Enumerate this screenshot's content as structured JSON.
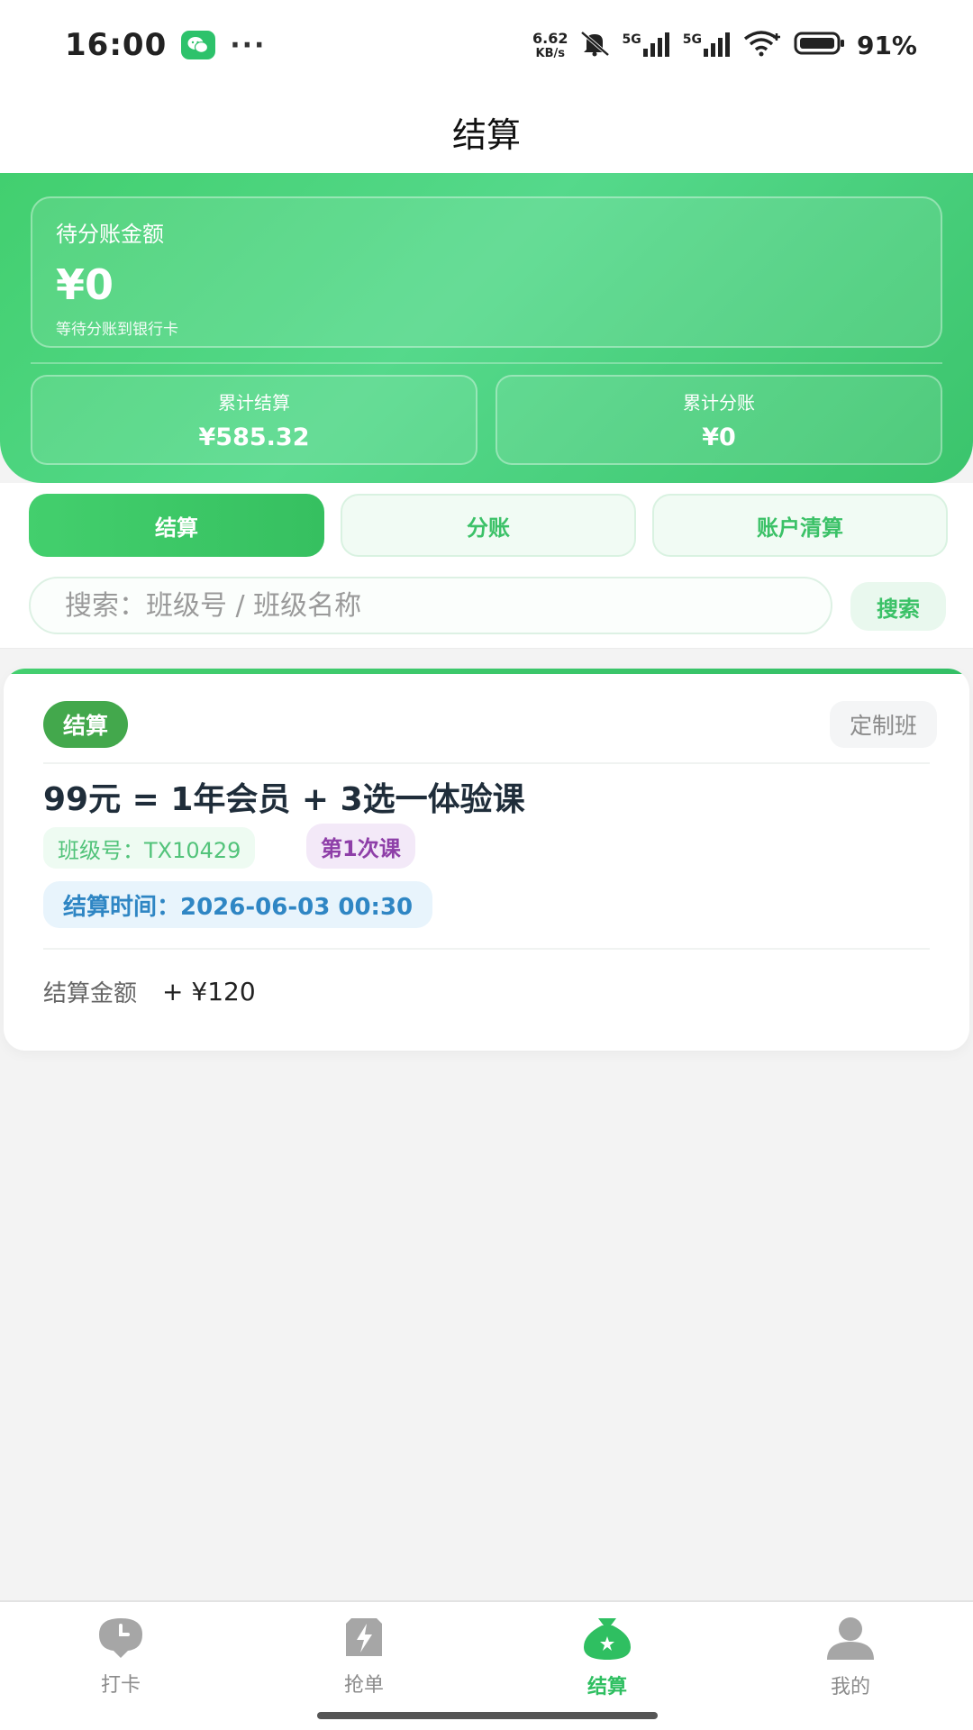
{
  "status_bar": {
    "time": "16:00",
    "more": "···",
    "net_speed_value": "6.62",
    "net_speed_unit": "KB/s",
    "signal_1_label": "5G",
    "signal_2_label": "5G",
    "battery_percent": "91%"
  },
  "header": {
    "title": "结算"
  },
  "summary": {
    "pending_label": "待分账金额",
    "pending_amount": "¥0",
    "pending_note": "等待分账到银行卡",
    "total_settled_label": "累计结算",
    "total_settled_value": "¥585.32",
    "total_split_label": "累计分账",
    "total_split_value": "¥0"
  },
  "tabs": [
    {
      "label": "结算",
      "active": true
    },
    {
      "label": "分账",
      "active": false
    },
    {
      "label": "账户清算",
      "active": false
    }
  ],
  "search": {
    "placeholder": "搜索：班级号 / 班级名称",
    "button_label": "搜索"
  },
  "orders": [
    {
      "status": "结算",
      "type": "定制班",
      "title": "99元 = 1年会员 + 3选一体验课",
      "class_no": "班级号：TX10429",
      "lesson": "第1次课",
      "settle_time": "结算时间：2026-06-03 00:30",
      "amount_label": "结算金额",
      "amount_value": "+ ¥120"
    }
  ],
  "bottom_nav": [
    {
      "label": "打卡",
      "icon": "clock-pin-icon",
      "active": false
    },
    {
      "label": "抢单",
      "icon": "lightning-icon",
      "active": false
    },
    {
      "label": "结算",
      "icon": "money-bag-icon",
      "active": true
    },
    {
      "label": "我的",
      "icon": "person-icon",
      "active": false
    }
  ],
  "colors": {
    "brand_green": "#3fcb6b",
    "status_badge": "#43a84c",
    "lesson_tag": "#8e3fa8",
    "time_tag": "#2f86c4"
  }
}
